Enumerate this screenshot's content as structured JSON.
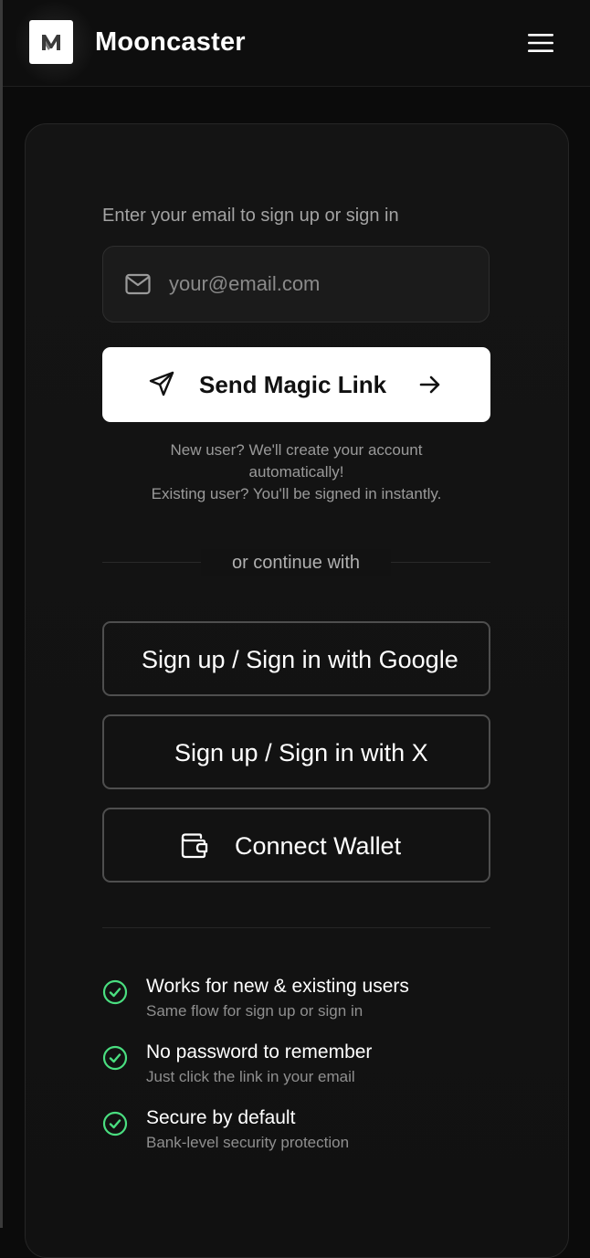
{
  "header": {
    "logo_letter": "M",
    "brand": "Mooncaster"
  },
  "auth": {
    "email_label": "Enter your email to sign up or sign in",
    "email_value": "",
    "email_placeholder": "your@email.com",
    "magic_link_label": "Send Magic Link",
    "info_line1": "New user? We'll create your account",
    "info_line2": "automatically!",
    "info_line3": "Existing user? You'll be signed in instantly.",
    "divider_label": "or continue with",
    "google_label": "Sign up / Sign in with Google",
    "x_label": "Sign up / Sign in with X",
    "wallet_label": "Connect Wallet"
  },
  "features": [
    {
      "title": "Works for new & existing users",
      "desc": "Same flow for sign up or sign in"
    },
    {
      "title": "No password to remember",
      "desc": "Just click the link in your email"
    },
    {
      "title": "Secure by default",
      "desc": "Bank-level security protection"
    }
  ],
  "icons": {
    "menu": "hamburger-menu-icon",
    "email": "mail-icon",
    "send": "send-icon",
    "arrow": "arrow-right-icon",
    "wallet": "wallet-icon",
    "check": "check-circle-icon"
  },
  "colors": {
    "background": "#0b0b0b",
    "card": "#141414",
    "primary_button": "#ffffff",
    "check": "#4ade80",
    "muted_text": "#9a9a9a"
  }
}
